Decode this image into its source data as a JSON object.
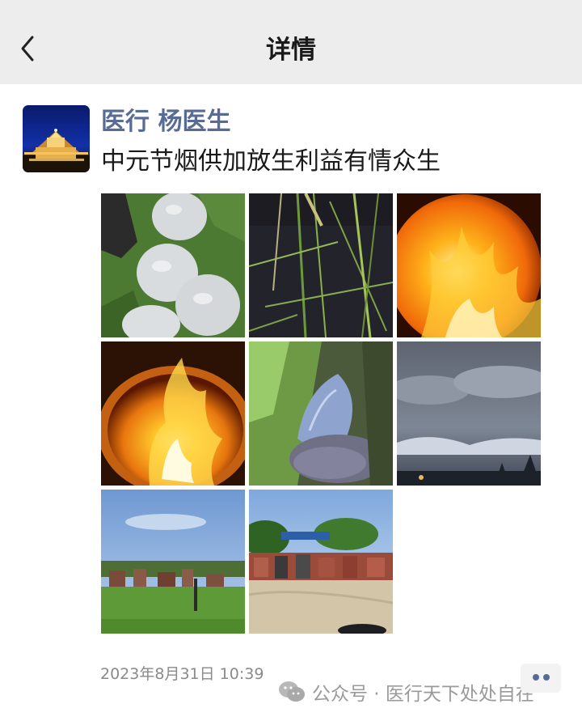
{
  "header": {
    "title": "详情",
    "back_icon": "chevron-left-icon"
  },
  "post": {
    "author": "医行 杨医生",
    "text": "中元节烟供加放生利益有情众生",
    "timestamp": "2023年8月31日 10:39",
    "photo_count": 8,
    "more_icon": "more-dots-icon"
  },
  "watermark": {
    "text": "公众号 · 医行天下处处自在",
    "icon": "wechat-icon"
  },
  "colors": {
    "header_bg": "#ededed",
    "author_link": "#576b95",
    "text": "#1a1a1a",
    "meta": "#8a8a8a"
  }
}
